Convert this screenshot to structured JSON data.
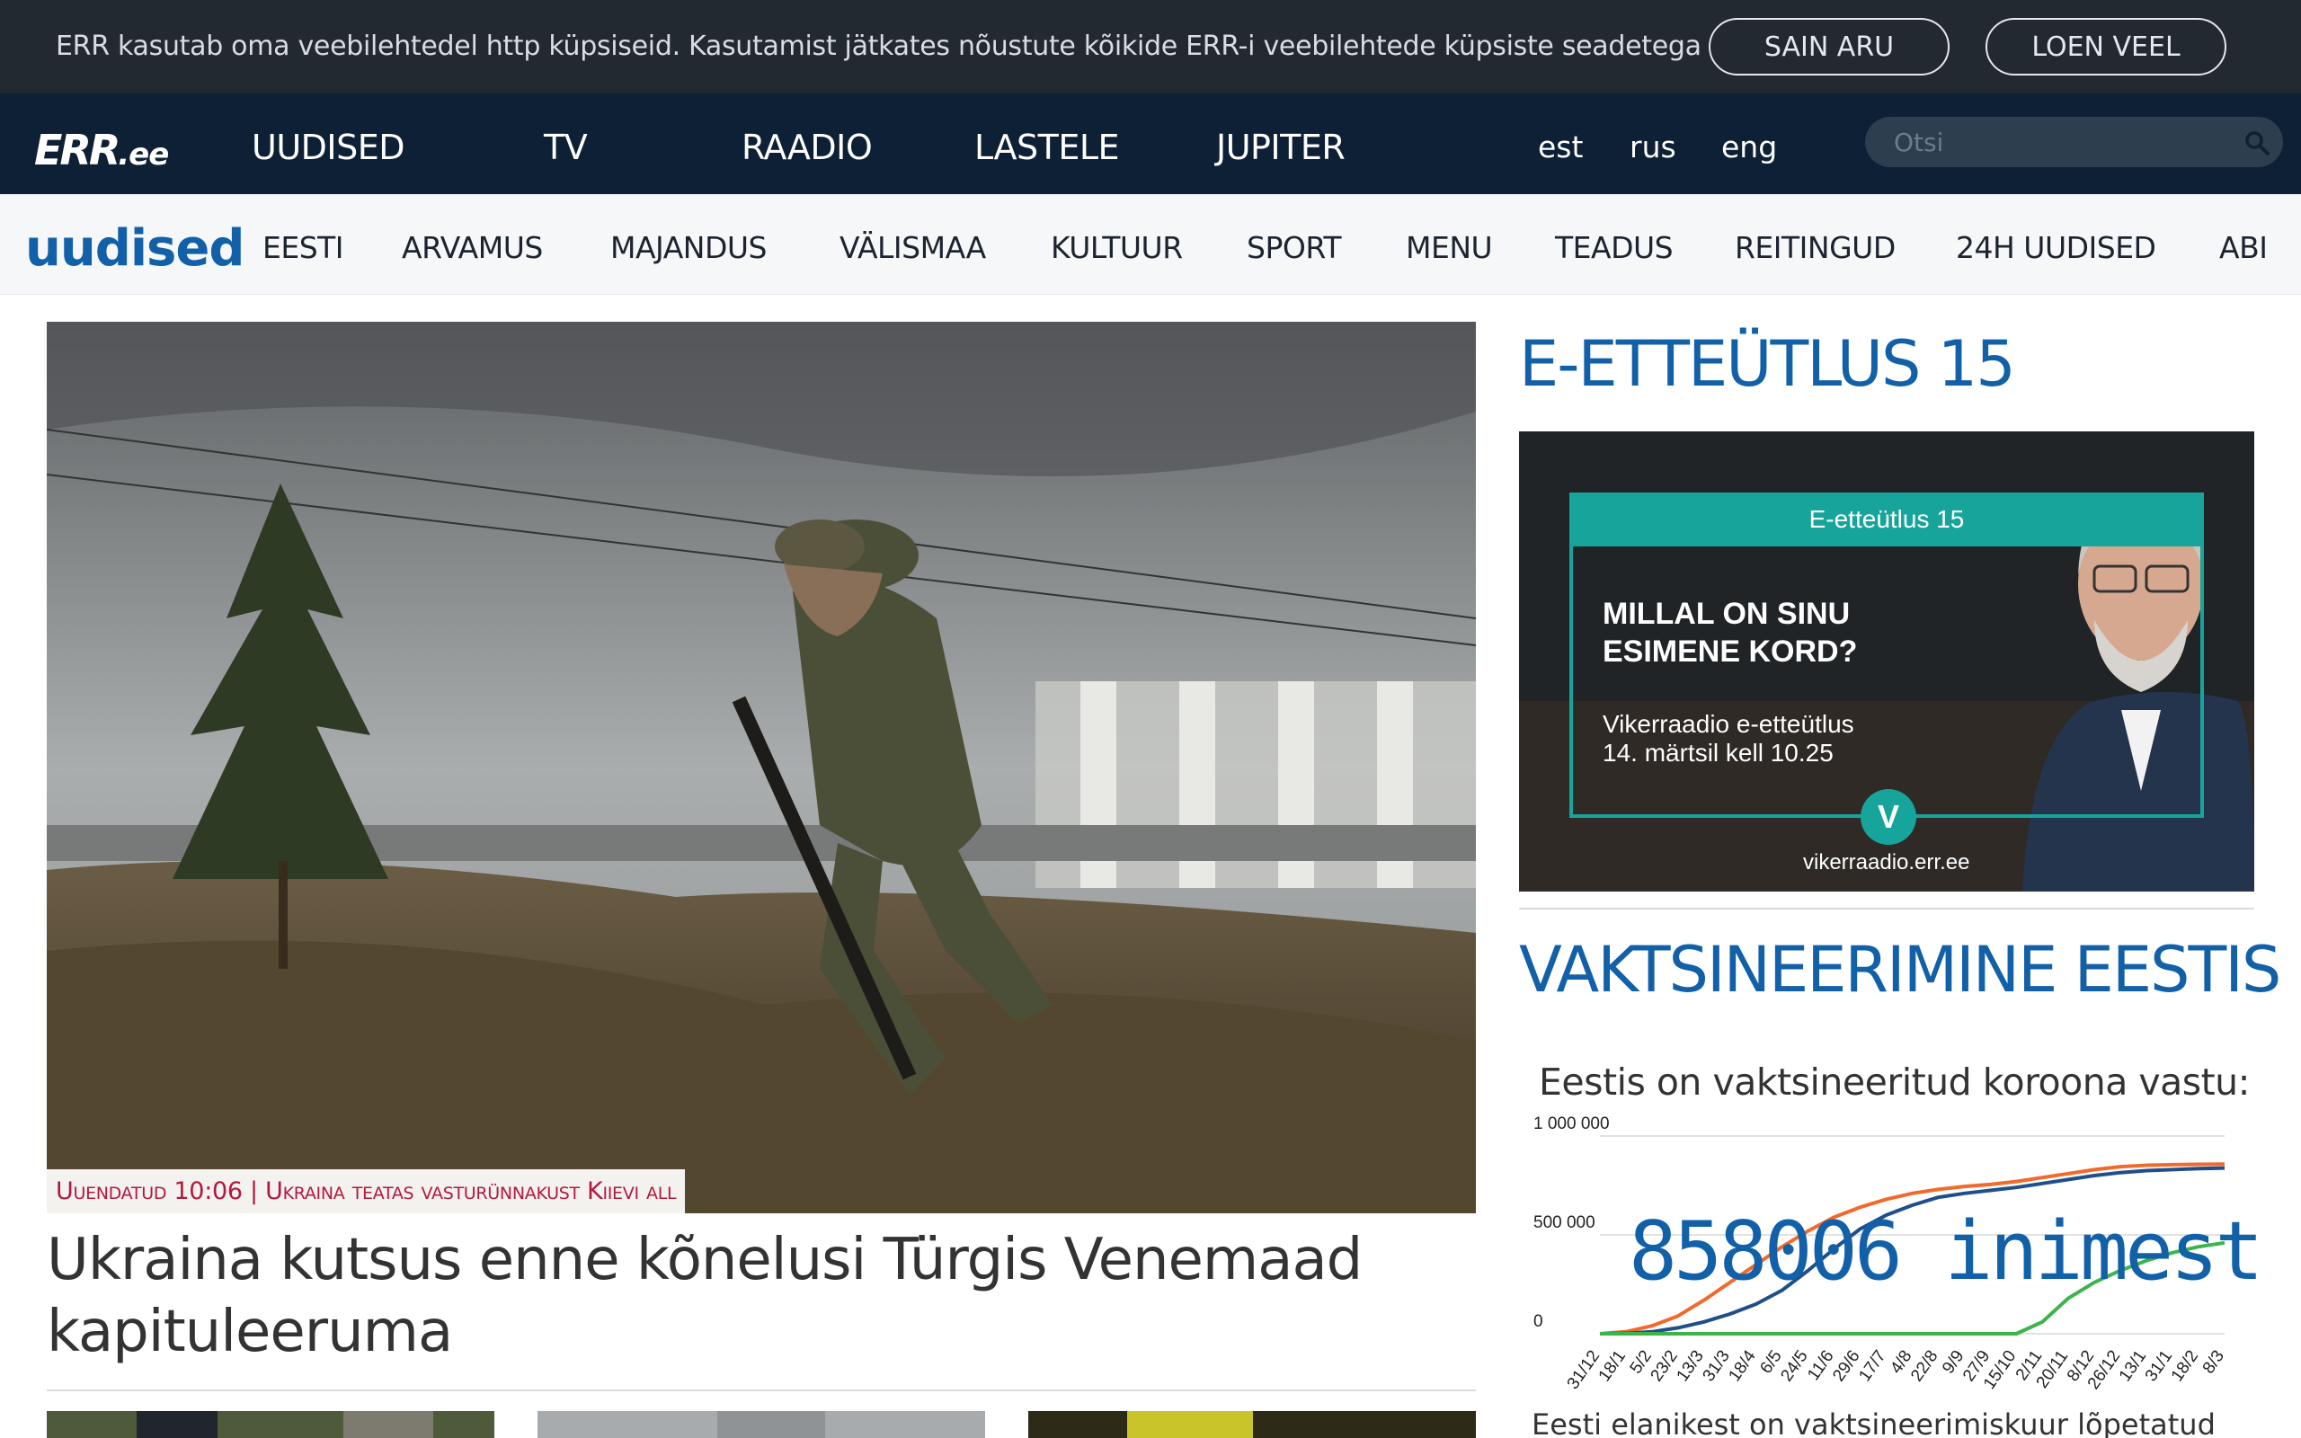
{
  "cookie": {
    "text": "ERR kasutab oma veebilehtedel http küpsiseid. Kasutamist jätkates nõustute kõikide ERR-i veebilehtede küpsiste seadetega",
    "accept_label": "SAIN ARU",
    "more_label": "LOEN VEEL"
  },
  "mainnav": {
    "logo": "ERR",
    "logo_suffix": ".ee",
    "items": [
      "UUDISED",
      "TV",
      "RAADIO",
      "LASTELE",
      "JUPITER"
    ],
    "languages": [
      "est",
      "rus",
      "eng"
    ],
    "search_placeholder": "Otsi"
  },
  "subnav": {
    "brand": "uudised",
    "items": [
      "EESTI",
      "ARVAMUS",
      "MAJANDUS",
      "VÄLISMAA",
      "KULTUUR",
      "SPORT",
      "MENU",
      "TEADUS",
      "REITINGUD",
      "24H UUDISED",
      "ABI"
    ]
  },
  "hero": {
    "caption": "Uuendatud 10:06 | Ukraina teatas vasturünnakust Kiievi all",
    "title": "Ukraina kutsus enne kõnelusi Türgis Venemaad kapituleeruma"
  },
  "sidebar": {
    "section1_title": "E-ETTEÜTLUS 15",
    "ad": {
      "band": "E-etteütlus 15",
      "headline": "MILLAL ON SINU\nESIMENE KORD?",
      "sub": "Vikerraadio e-etteütlus\n14. märtsil kell 10.25",
      "url": "vikerraadio.err.ee",
      "badge": "V"
    },
    "section2_title": "VAKTSINEERIMINE EESTIS",
    "vax_heading": "Eestis on vaktsineeritud koroona vastu:",
    "vax_count": "858006 inimest",
    "vax_footer": "Eesti elanikest on vaktsineerimiskuur lõpetatud"
  },
  "chart_data": {
    "type": "line",
    "title": "",
    "ylabel": "",
    "xlabel": "",
    "ylim": [
      0,
      1000000
    ],
    "yticks": [
      "1 000 000",
      "500 000",
      "0"
    ],
    "categories": [
      "31/12",
      "18/1",
      "5/2",
      "23/2",
      "13/3",
      "31/3",
      "18/4",
      "6/5",
      "24/5",
      "11/6",
      "29/6",
      "17/7",
      "4/8",
      "22/8",
      "9/9",
      "27/9",
      "15/10",
      "2/11",
      "20/11",
      "8/12",
      "26/12",
      "13/1",
      "31/1",
      "18/2",
      "8/3"
    ],
    "series": [
      {
        "color": "#f26a2b",
        "values": [
          0,
          10000,
          40000,
          90000,
          170000,
          260000,
          350000,
          440000,
          520000,
          590000,
          640000,
          680000,
          710000,
          730000,
          745000,
          755000,
          770000,
          790000,
          810000,
          830000,
          845000,
          852000,
          855000,
          857000,
          858006
        ]
      },
      {
        "color": "#1f4e8c",
        "values": [
          0,
          2000,
          10000,
          30000,
          60000,
          100000,
          150000,
          220000,
          320000,
          430000,
          530000,
          600000,
          650000,
          690000,
          710000,
          725000,
          740000,
          760000,
          780000,
          800000,
          815000,
          825000,
          830000,
          835000,
          838000
        ]
      },
      {
        "color": "#3cb44b",
        "values": [
          0,
          0,
          0,
          0,
          0,
          0,
          0,
          0,
          0,
          0,
          0,
          0,
          0,
          0,
          0,
          0,
          0,
          60000,
          180000,
          260000,
          320000,
          370000,
          410000,
          440000,
          460000
        ]
      }
    ]
  }
}
